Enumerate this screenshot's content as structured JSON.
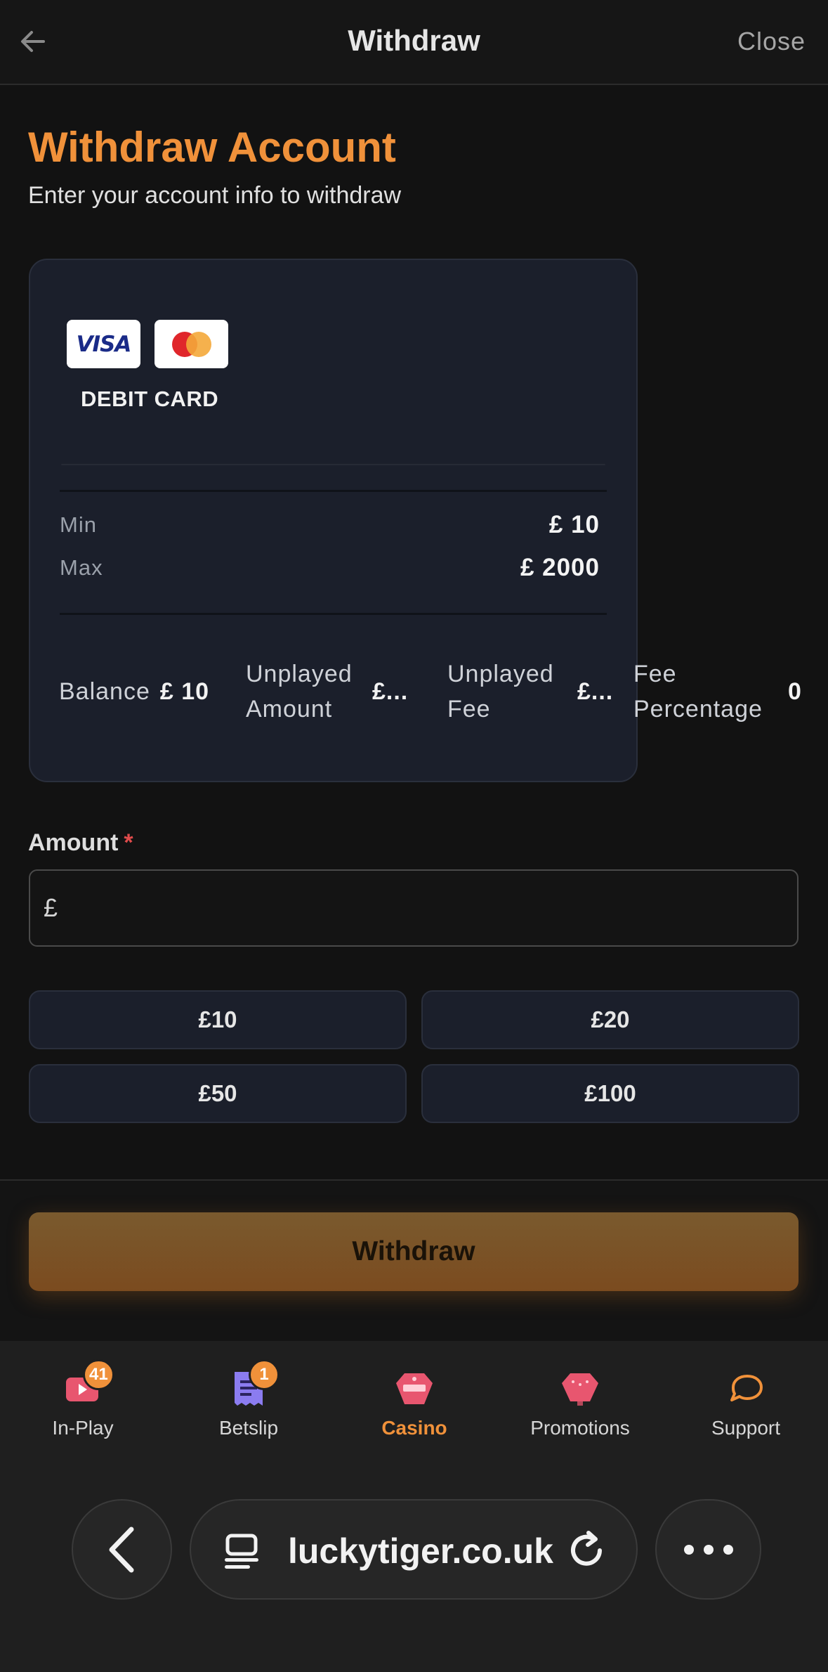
{
  "header": {
    "title": "Withdraw",
    "close_label": "Close"
  },
  "page": {
    "title": "Withdraw Account",
    "subtitle": "Enter your account info to withdraw"
  },
  "card": {
    "logos": [
      "visa-logo",
      "mastercard-logo"
    ],
    "visa_text": "VISA",
    "label": "DEBIT CARD",
    "min_label": "Min",
    "min_value": "£ 10",
    "max_label": "Max",
    "max_value": "£ 2000",
    "stats": [
      {
        "label": "Balance",
        "value": "£ 10"
      },
      {
        "label": "Unplayed Amount",
        "value": "£..."
      },
      {
        "label": "Unplayed Fee",
        "value": "£..."
      },
      {
        "label": "Fee Percentage",
        "value": "0"
      }
    ]
  },
  "amount": {
    "label": "Amount",
    "required_mark": "*",
    "currency": "£",
    "value": "",
    "placeholder": ""
  },
  "quick_amounts": [
    "£10",
    "£20",
    "£50",
    "£100"
  ],
  "action": {
    "withdraw_label": "Withdraw"
  },
  "nav": {
    "items": [
      {
        "label": "In-Play",
        "icon": "in-play-icon",
        "badge": "41"
      },
      {
        "label": "Betslip",
        "icon": "betslip-icon",
        "badge": "1"
      },
      {
        "label": "Casino",
        "icon": "casino-icon",
        "active": true
      },
      {
        "label": "Promotions",
        "icon": "promotions-icon"
      },
      {
        "label": "Support",
        "icon": "chat-icon"
      }
    ]
  },
  "browser": {
    "url": "luckytiger.co.uk"
  },
  "colors": {
    "accent": "#f0913a",
    "card_bg": "#1b1f2b",
    "page_bg": "#121212",
    "required": "#e04b4b"
  }
}
